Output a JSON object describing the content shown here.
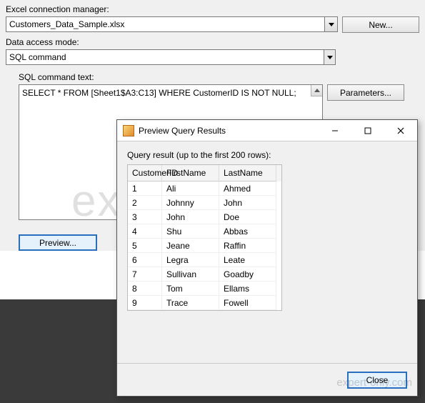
{
  "labels": {
    "connection_manager": "Excel connection manager:",
    "data_access_mode": "Data access mode:",
    "sql_command_text": "SQL command text:"
  },
  "connection": {
    "value": "Customers_Data_Sample.xlsx",
    "new_button": "New..."
  },
  "data_access": {
    "value": "SQL command"
  },
  "sql": {
    "text": "SELECT * FROM [Sheet1$A3:C13] WHERE CustomerID IS NOT NULL;",
    "parameters_button": "Parameters...",
    "preview_button": "Preview..."
  },
  "dialog": {
    "title": "Preview Query Results",
    "hint": "Query result (up to the first 200 rows):",
    "columns": [
      "CustomerID",
      "FirstName",
      "LastName"
    ],
    "rows": [
      [
        "1",
        "Ali",
        "Ahmed"
      ],
      [
        "2",
        "Johnny",
        "John"
      ],
      [
        "3",
        "John",
        "Doe"
      ],
      [
        "4",
        "Shu",
        "Abbas"
      ],
      [
        "5",
        "Jeane",
        "Raffin"
      ],
      [
        "6",
        "Legra",
        "Leate"
      ],
      [
        "7",
        "Sullivan",
        "Goadby"
      ],
      [
        "8",
        "Tom",
        "Ellams"
      ],
      [
        "9",
        "Trace",
        "Fowell"
      ]
    ],
    "close_button": "Close"
  },
  "watermarks": {
    "big": "expert-only.com",
    "small": "expert-only.com"
  }
}
